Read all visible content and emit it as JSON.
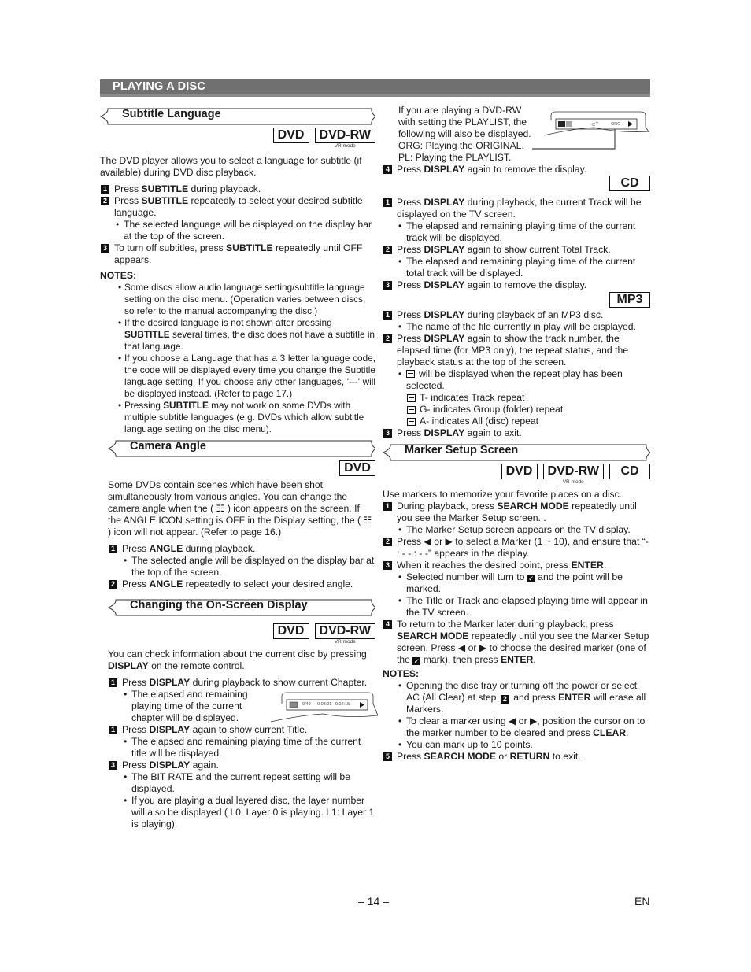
{
  "header": {
    "title": "PLAYING A DISC"
  },
  "subtitle_section": {
    "title": "Subtitle Language",
    "badges": [
      {
        "label": "DVD",
        "sub": ""
      },
      {
        "label": "DVD-RW",
        "sub": "VR mode"
      }
    ],
    "intro": "The DVD player allows you to select a language for subtitle (if available) during DVD disc playback.",
    "steps": [
      {
        "num": "1",
        "pre": "Press ",
        "bold": "SUBTITLE",
        "post": " during playback."
      },
      {
        "num": "2",
        "pre": "Press ",
        "bold": "SUBTITLE",
        "post": " repeatedly to select your desired subtitle language."
      },
      {
        "num": "3",
        "pre": "To turn off subtitles, press ",
        "bold": "SUBTITLE",
        "post": " repeatedly until OFF appears."
      }
    ],
    "step2_bullet": "The selected language will be displayed on the display bar at the top of the screen.",
    "notes_label": "NOTES:",
    "notes": [
      {
        "pre": "Some discs allow audio language setting/subtitle language setting on the disc menu. (Operation varies between discs, so refer to the manual accompanying the disc.)",
        "bold": "",
        "post": ""
      },
      {
        "pre": "If the desired language is not shown after pressing ",
        "bold": "SUBTITLE",
        "post": " several times, the disc does not have a subtitle in that language."
      },
      {
        "pre": "If you choose a Language that has a 3 letter language code, the code will be displayed every time you change the Subtitle language setting. If you choose any other languages, '---' will be displayed instead. (Refer to page 17.)",
        "bold": "",
        "post": ""
      },
      {
        "pre": "Pressing ",
        "bold": "SUBTITLE",
        "post": " may not work on some DVDs with multiple subtitle languages (e.g. DVDs which allow subtitle language setting on the disc menu)."
      }
    ]
  },
  "angle_section": {
    "title": "Camera Angle",
    "badges": [
      {
        "label": "DVD"
      }
    ],
    "intro": "Some DVDs contain scenes which have been shot simultaneously from various angles. You can change the camera angle when the ( ☷ ) icon appears on the screen. If the ANGLE ICON setting is OFF in the Display setting, the ( ☷ ) icon will not appear. (Refer to page 16.)",
    "steps": [
      {
        "num": "1",
        "pre": "Press ",
        "bold": "ANGLE",
        "post": " during playback."
      },
      {
        "num": "2",
        "pre": "Press ",
        "bold": "ANGLE",
        "post": " repeatedly to select your desired angle."
      }
    ],
    "step1_bullet": "The selected angle will be displayed on the display bar at the top of the screen."
  },
  "display_section": {
    "title": "Changing the On-Screen Display",
    "badges": [
      {
        "label": "DVD",
        "sub": ""
      },
      {
        "label": "DVD-RW",
        "sub": "VR mode"
      }
    ],
    "intro_pre": "You can check information about the current disc by pressing ",
    "intro_bold": "DISPLAY",
    "intro_post": " on the remote control.",
    "steps": [
      {
        "num": "1",
        "pre": "Press ",
        "bold": "DISPLAY",
        "post": " during playback to show current Chapter."
      },
      {
        "num": "1",
        "pre": "Press ",
        "bold": "DISPLAY",
        "post": " again to show current Title."
      },
      {
        "num": "3",
        "pre": "Press ",
        "bold": "DISPLAY",
        "post": " again."
      }
    ],
    "step1_bullet": "The elapsed and remaining playing time of the current chapter will be displayed.",
    "step2_bullet": "The elapsed and remaining playing time of the current title will be displayed.",
    "step3_bullets": [
      "The BIT RATE and the current repeat setting will be displayed.",
      "If you are playing a dual layered disc, the layer number will also be displayed ( L0: Layer 0 is playing.  L1: Layer 1 is playing)."
    ],
    "osd_chapter": {
      "chapter": "9/49",
      "elapsed": "0:03:21",
      "remaining": "-0:02:15"
    },
    "playlist_text": [
      "If you are playing a DVD-RW",
      "with setting the PLAYLIST, the",
      "following will also be displayed.",
      "ORG: Playing the ORIGINAL.",
      "PL: Playing the PLAYLIST."
    ],
    "osd_playlist": {
      "repeat": "T",
      "mode": "ORG"
    },
    "step4": {
      "num": "4",
      "pre": "Press ",
      "bold": "DISPLAY",
      "post": " again to remove the display."
    }
  },
  "cd_section": {
    "badge": "CD",
    "steps": [
      {
        "num": "1",
        "pre": "Press ",
        "bold": "DISPLAY",
        "post": " during playback, the current Track will be displayed on the TV screen."
      },
      {
        "num": "2",
        "pre": "Press ",
        "bold": "DISPLAY",
        "post": " again to show current Total Track."
      },
      {
        "num": "3",
        "pre": "Press ",
        "bold": "DISPLAY",
        "post": " again to remove the display."
      }
    ],
    "step1_bullet": "The elapsed and remaining playing time of the current track will be displayed.",
    "step2_bullet": "The elapsed and remaining playing time of the current total track will be displayed."
  },
  "mp3_section": {
    "badge": "MP3",
    "steps": [
      {
        "num": "1",
        "pre": "Press ",
        "bold": "DISPLAY",
        "post": " during playback of an MP3 disc."
      },
      {
        "num": "2",
        "pre": "Press ",
        "bold": "DISPLAY",
        "post": " again to show the track number, the elapsed time (for MP3 only), the repeat status, and the playback status at the top of the screen."
      },
      {
        "num": "3",
        "pre": "Press ",
        "bold": "DISPLAY",
        "post": " again to exit."
      }
    ],
    "step1_bullet": "The name of the file currently in play will be displayed.",
    "step2_bullet": "will be displayed when the repeat play has been selected.",
    "repeat_modes": [
      "T- indicates Track repeat",
      "G- indicates Group (folder) repeat",
      "A- indicates All (disc) repeat"
    ]
  },
  "marker_section": {
    "title": "Marker Setup Screen",
    "badges": [
      {
        "label": "DVD",
        "sub": ""
      },
      {
        "label": "DVD-RW",
        "sub": "VR mode"
      },
      {
        "label": "CD",
        "sub": ""
      }
    ],
    "intro": "Use markers to memorize your favorite places on a disc.",
    "step1": {
      "num": "1",
      "pre": "During playback, press ",
      "bold": "SEARCH MODE",
      "post": " repeatedly until you see the Marker Setup screen. ."
    },
    "step1_bullet": "The Marker Setup screen appears on the TV display.",
    "step2": {
      "num": "2",
      "text": "Press ◀ or ▶ to select a Marker (1 ~ 10), and ensure that “- : - - : - -” appears in the display."
    },
    "step3": {
      "num": "3",
      "pre": "When it reaches the desired point, press ",
      "bold": "ENTER",
      "post": "."
    },
    "step3_bullets": [
      {
        "pre": "Selected number will turn to ",
        "post": " and the point will be marked."
      },
      {
        "pre": "The Title or Track and elapsed playing time will appear in the TV screen.",
        "post": ""
      }
    ],
    "step4": {
      "num": "4",
      "pre": "To return to the Marker later during playback, press ",
      "bold": "SEARCH MODE",
      "mid": " repeatedly until you see the Marker Setup screen. Press ◀ or ▶ to choose the desired marker (one of the ",
      "mid2": " mark), then press ",
      "bold2": "ENTER",
      "post": "."
    },
    "notes_label": "NOTES:",
    "notes": [
      {
        "pre": "Opening the disc tray or turning off the power or select AC (All Clear) at step ",
        "step": "2",
        "mid": " and press ",
        "bold": "ENTER",
        "post": " will erase all Markers."
      },
      {
        "pre": "To clear a marker using ◀ or ▶, position the cursor on to the marker number to be cleared and press ",
        "bold": "CLEAR",
        "post": "."
      },
      {
        "pre": "You can mark up to 10 points.",
        "bold": "",
        "post": ""
      }
    ],
    "step5": {
      "num": "5",
      "pre": "Press ",
      "bold": "SEARCH MODE",
      "mid": " or ",
      "bold2": "RETURN",
      "post": " to exit."
    }
  },
  "footer": {
    "page": "– 14 –",
    "lang": "EN"
  }
}
